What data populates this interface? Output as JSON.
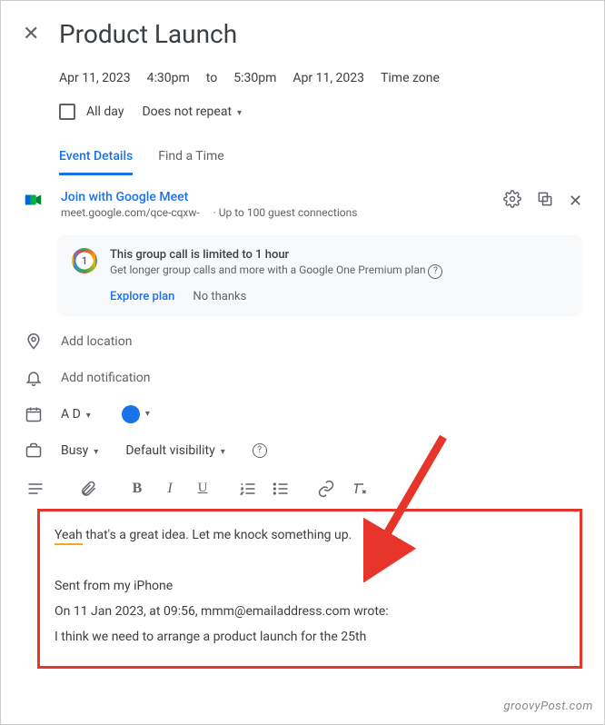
{
  "header": {
    "title": "Product Launch"
  },
  "datetime": {
    "start_date": "Apr 11, 2023",
    "start_time": "4:30pm",
    "to": "to",
    "end_time": "5:30pm",
    "end_date": "Apr 11, 2023",
    "tz_label": "Time zone"
  },
  "allday": {
    "label": "All day",
    "recurrence": "Does not repeat"
  },
  "tabs": {
    "details": "Event Details",
    "findtime": "Find a Time"
  },
  "meet": {
    "join": "Join with Google Meet",
    "link": "meet.google.com/qce-cqxw-",
    "sub": "· Up to 100 guest connections"
  },
  "one": {
    "badge": "1",
    "title": "This group call is limited to 1 hour",
    "sub": "Get longer group calls and more with a Google One Premium plan",
    "explore": "Explore plan",
    "nothanks": "No thanks"
  },
  "location": {
    "placeholder": "Add location"
  },
  "notification": {
    "placeholder": "Add notification"
  },
  "calendar_sel": {
    "label": "A D"
  },
  "availability": {
    "busy": "Busy",
    "visibility": "Default visibility"
  },
  "description": {
    "yeah": "Yeah",
    "line1_rest": " that's a great idea. Let me knock something up.",
    "sent_from": "Sent from my iPhone",
    "quote_header": "On 11 Jan 2023, at 09:56, mmm@emailaddress.com wrote:",
    "quote_body": "I think we need to arrange a product launch for the 25th"
  },
  "watermark": "groovyPost.com"
}
